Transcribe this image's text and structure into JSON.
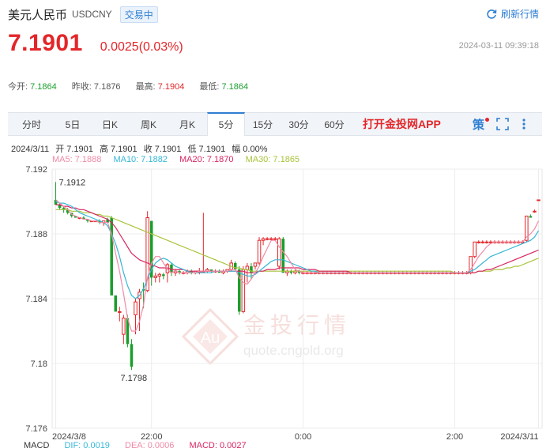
{
  "header": {
    "name": "美元人民币",
    "code": "USDCNY",
    "status": "交易中",
    "refresh_label": "刷新行情"
  },
  "quote": {
    "price": "7.1901",
    "change": "0.0025(0.03%)",
    "timestamp": "2024-03-11 09:39:18"
  },
  "stats": {
    "open_label": "今开:",
    "open": "7.1864",
    "prev_label": "昨收:",
    "prev": "7.1876",
    "high_label": "最高:",
    "high": "7.1904",
    "low_label": "最低:",
    "low": "7.1864"
  },
  "tabs": [
    "分时",
    "5日",
    "日K",
    "周K",
    "月K",
    "5分",
    "15分",
    "30分",
    "60分"
  ],
  "active_tab": "5分",
  "app_link": "打开金投网APP",
  "strategy_label": "策",
  "ohlc": {
    "date": "2024/3/11",
    "open": "开 7.1901",
    "high": "高 7.1901",
    "close": "收 7.1901",
    "low": "低 7.1901",
    "amp": "幅 0.00%"
  },
  "ma_legend": {
    "ma5": "MA5: 7.1888",
    "ma10": "MA10: 7.1882",
    "ma20": "MA20: 7.1870",
    "ma30": "MA30: 7.1865"
  },
  "macd_legend": {
    "title": "MACD",
    "dif": "DIF: 0.0019",
    "dea": "DEA: 0.0006",
    "macd": "MACD: 0.0027"
  },
  "colors": {
    "up": "#e3262a",
    "down": "#1a9e2c",
    "ma5": "#f08aa6",
    "ma10": "#35b7d6",
    "ma20": "#d9245f",
    "ma30": "#a7c43a",
    "accent": "#2f7fd3"
  },
  "watermark": {
    "text": "金投行情",
    "url": "quote.cngold.org"
  },
  "chart_data": {
    "type": "candlestick",
    "y_ticks": [
      "7.192",
      "7.188",
      "7.184",
      "7.18",
      "7.176"
    ],
    "ylim": [
      7.176,
      7.192
    ],
    "x_ticks": [
      {
        "label": "2024/3/8",
        "i": 0
      },
      {
        "label": "22:00",
        "i": 24
      },
      {
        "label": "0:00",
        "i": 62
      },
      {
        "label": "2:00",
        "i": 100
      },
      {
        "label": "2024/3/11",
        "i": 121
      }
    ],
    "annotations": {
      "max": "7.1912",
      "min": "7.1798"
    },
    "grid": true,
    "candles": [
      [
        7.1901,
        7.1912,
        7.1898,
        7.1898
      ],
      [
        7.1898,
        7.1899,
        7.1895,
        7.1896
      ],
      [
        7.1896,
        7.1897,
        7.1893,
        7.1895
      ],
      [
        7.1895,
        7.1896,
        7.1892,
        7.1893
      ],
      [
        7.1893,
        7.1893,
        7.189,
        7.1891
      ],
      [
        7.1891,
        7.1891,
        7.189,
        7.189
      ],
      [
        7.189,
        7.189,
        7.1889,
        7.189
      ],
      [
        7.189,
        7.1891,
        7.1889,
        7.1889
      ],
      [
        7.1889,
        7.1889,
        7.1887,
        7.1888
      ],
      [
        7.1888,
        7.1888,
        7.1888,
        7.1888
      ],
      [
        7.1888,
        7.1888,
        7.1888,
        7.1888
      ],
      [
        7.1888,
        7.1889,
        7.1886,
        7.1887
      ],
      [
        7.1887,
        7.1888,
        7.1885,
        7.1888
      ],
      [
        7.1889,
        7.189,
        7.1887,
        7.1887
      ],
      [
        7.189,
        7.1891,
        7.1848,
        7.1842
      ],
      [
        7.1842,
        7.1842,
        7.1832,
        7.1832
      ],
      [
        7.1832,
        7.1835,
        7.1826,
        7.1832
      ],
      [
        7.1818,
        7.183,
        7.1812,
        7.1828
      ],
      [
        7.1828,
        7.183,
        7.181,
        7.1812
      ],
      [
        7.1812,
        7.1815,
        7.1796,
        7.1798
      ],
      [
        7.183,
        7.184,
        7.1818,
        7.1838
      ],
      [
        7.184,
        7.1846,
        7.182,
        7.1844
      ],
      [
        7.1846,
        7.185,
        7.1834,
        7.1845
      ],
      [
        7.1845,
        7.1894,
        7.1844,
        7.189
      ],
      [
        7.1888,
        7.1888,
        7.1848,
        7.1853
      ],
      [
        7.1853,
        7.1856,
        7.185,
        7.1854
      ],
      [
        7.1854,
        7.1856,
        7.185,
        7.1855
      ],
      [
        7.1855,
        7.1856,
        7.1852,
        7.1854
      ],
      [
        7.1856,
        7.1862,
        7.185,
        7.1861
      ],
      [
        7.1861,
        7.1862,
        7.1854,
        7.1856
      ],
      [
        7.1856,
        7.1858,
        7.1854,
        7.1857
      ],
      [
        7.1857,
        7.1858,
        7.1855,
        7.1856
      ],
      [
        7.1856,
        7.1857,
        7.1855,
        7.1856
      ],
      [
        7.1856,
        7.1858,
        7.1855,
        7.1857
      ],
      [
        7.1857,
        7.1858,
        7.1855,
        7.1856
      ],
      [
        7.1856,
        7.1857,
        7.1855,
        7.1857
      ],
      [
        7.1857,
        7.1859,
        7.1855,
        7.1857
      ],
      [
        7.1857,
        7.1893,
        7.1857,
        7.1857
      ],
      [
        7.1857,
        7.1859,
        7.1856,
        7.1858
      ],
      [
        7.1858,
        7.1858,
        7.1856,
        7.1857
      ],
      [
        7.1857,
        7.1858,
        7.1856,
        7.1857
      ],
      [
        7.1857,
        7.1858,
        7.1856,
        7.1856
      ],
      [
        7.1856,
        7.1858,
        7.1855,
        7.1857
      ],
      [
        7.1857,
        7.1858,
        7.1856,
        7.1858
      ],
      [
        7.1858,
        7.1864,
        7.1857,
        7.1862
      ],
      [
        7.1862,
        7.1863,
        7.1858,
        7.1858
      ],
      [
        7.1858,
        7.186,
        7.183,
        7.1832
      ],
      [
        7.1832,
        7.186,
        7.1831,
        7.1858
      ],
      [
        7.1858,
        7.1862,
        7.185,
        7.186
      ],
      [
        7.186,
        7.1862,
        7.1852,
        7.1856
      ],
      [
        7.186,
        7.1862,
        7.1858,
        7.1862
      ],
      [
        7.1862,
        7.1878,
        7.1861,
        7.1876
      ],
      [
        7.1876,
        7.1878,
        7.1873,
        7.1877
      ],
      [
        7.1877,
        7.1878,
        7.1876,
        7.1877
      ],
      [
        7.1877,
        7.1878,
        7.1876,
        7.1877
      ],
      [
        7.1877,
        7.1878,
        7.1876,
        7.1877
      ],
      [
        7.186,
        7.1878,
        7.1858,
        7.1877
      ],
      [
        7.1877,
        7.1878,
        7.1856,
        7.1856
      ],
      [
        7.1856,
        7.1858,
        7.1854,
        7.1857
      ],
      [
        7.1857,
        7.1858,
        7.1855,
        7.1856
      ],
      [
        7.1856,
        7.1858,
        7.1855,
        7.1857
      ],
      [
        7.1857,
        7.1858,
        7.1855,
        7.1856
      ],
      [
        7.1856,
        7.1857,
        7.1855,
        7.1856
      ],
      [
        7.1856,
        7.1857,
        7.1855,
        7.1856
      ],
      [
        7.1856,
        7.1857,
        7.1855,
        7.1856
      ],
      [
        7.1856,
        7.1857,
        7.1855,
        7.1856
      ],
      [
        7.1856,
        7.1857,
        7.1855,
        7.1856
      ],
      [
        7.1856,
        7.1857,
        7.1855,
        7.1856
      ],
      [
        7.1856,
        7.1857,
        7.1855,
        7.1856
      ],
      [
        7.1856,
        7.1857,
        7.1855,
        7.1856
      ],
      [
        7.1856,
        7.1857,
        7.1855,
        7.1856
      ],
      [
        7.1856,
        7.1857,
        7.1855,
        7.1856
      ],
      [
        7.1856,
        7.1857,
        7.1855,
        7.1856
      ],
      [
        7.1856,
        7.1857,
        7.1855,
        7.1856
      ],
      [
        7.1856,
        7.1857,
        7.1855,
        7.1856
      ],
      [
        7.1856,
        7.1857,
        7.1855,
        7.1856
      ],
      [
        7.1856,
        7.1857,
        7.1855,
        7.1856
      ],
      [
        7.1856,
        7.1857,
        7.1855,
        7.1856
      ],
      [
        7.1856,
        7.1857,
        7.1855,
        7.1856
      ],
      [
        7.1856,
        7.1857,
        7.1855,
        7.1856
      ],
      [
        7.1856,
        7.1857,
        7.1855,
        7.1856
      ],
      [
        7.1856,
        7.1857,
        7.1855,
        7.1856
      ],
      [
        7.1856,
        7.1857,
        7.1855,
        7.1856
      ],
      [
        7.1856,
        7.1857,
        7.1855,
        7.1856
      ],
      [
        7.1856,
        7.1857,
        7.1855,
        7.1856
      ],
      [
        7.1856,
        7.1857,
        7.1855,
        7.1856
      ],
      [
        7.1856,
        7.1857,
        7.1855,
        7.1856
      ],
      [
        7.1856,
        7.1857,
        7.1855,
        7.1856
      ],
      [
        7.1856,
        7.1857,
        7.1855,
        7.1856
      ],
      [
        7.1856,
        7.1857,
        7.1855,
        7.1856
      ],
      [
        7.1856,
        7.1857,
        7.1855,
        7.1856
      ],
      [
        7.1856,
        7.1857,
        7.1855,
        7.1856
      ],
      [
        7.1856,
        7.1857,
        7.1855,
        7.1856
      ],
      [
        7.1856,
        7.1857,
        7.1855,
        7.1856
      ],
      [
        7.1856,
        7.1857,
        7.1855,
        7.1856
      ],
      [
        7.1856,
        7.1857,
        7.1855,
        7.1856
      ],
      [
        7.1856,
        7.1857,
        7.1855,
        7.1856
      ],
      [
        7.1856,
        7.1857,
        7.1855,
        7.1856
      ],
      [
        7.1856,
        7.1857,
        7.1855,
        7.1856
      ],
      [
        7.1856,
        7.1857,
        7.1855,
        7.1856
      ],
      [
        7.1856,
        7.1857,
        7.1855,
        7.1856
      ],
      [
        7.1856,
        7.1857,
        7.1855,
        7.1856
      ],
      [
        7.1856,
        7.1857,
        7.1855,
        7.1856
      ],
      [
        7.1856,
        7.1857,
        7.1855,
        7.1856
      ],
      [
        7.1856,
        7.1866,
        7.1855,
        7.1866
      ],
      [
        7.1866,
        7.1875,
        7.1865,
        7.1875
      ],
      [
        7.1875,
        7.1876,
        7.1874,
        7.1875
      ],
      [
        7.1875,
        7.1876,
        7.1874,
        7.1875
      ],
      [
        7.1875,
        7.1876,
        7.1874,
        7.1875
      ],
      [
        7.1875,
        7.1876,
        7.1874,
        7.1875
      ],
      [
        7.1875,
        7.1876,
        7.1874,
        7.1875
      ],
      [
        7.1875,
        7.1876,
        7.1874,
        7.1875
      ],
      [
        7.1875,
        7.1876,
        7.1874,
        7.1875
      ],
      [
        7.1875,
        7.1876,
        7.1874,
        7.1875
      ],
      [
        7.1875,
        7.1876,
        7.1874,
        7.1875
      ],
      [
        7.1875,
        7.1876,
        7.1874,
        7.1875
      ],
      [
        7.1875,
        7.1876,
        7.1874,
        7.1875
      ],
      [
        7.1875,
        7.1876,
        7.1874,
        7.1875
      ],
      [
        7.1876,
        7.1891,
        7.1875,
        7.1891
      ],
      [
        7.1891,
        7.1892,
        7.189,
        7.189
      ],
      [
        7.1894,
        7.1895,
        7.1893,
        7.1894
      ],
      [
        7.1901,
        7.1901,
        7.1901,
        7.1901
      ]
    ],
    "ma5": [
      7.1901,
      7.1899,
      7.1897,
      7.1895,
      7.1892,
      7.1891,
      7.189,
      7.1889,
      7.1889,
      7.1888,
      7.1888,
      7.1887,
      7.1887,
      7.1887,
      7.188,
      7.1868,
      7.1857,
      7.1843,
      7.1828,
      7.182,
      7.182,
      7.1826,
      7.1836,
      7.1853,
      7.1862,
      7.1866,
      7.1866,
      7.1862,
      7.1858,
      7.1856,
      7.1857,
      7.1856,
      7.1856,
      7.1856,
      7.1856,
      7.1856,
      7.1857,
      7.1857,
      7.1857,
      7.1857,
      7.1857,
      7.1857,
      7.1857,
      7.1857,
      7.1858,
      7.1858,
      7.1853,
      7.185,
      7.1849,
      7.1852,
      7.1856,
      7.186,
      7.1866,
      7.1871,
      7.1876,
      7.1876,
      7.1872,
      7.1869,
      7.1866,
      7.1862,
      7.1858,
      7.1857,
      7.1856,
      7.1856,
      7.1856,
      7.1856,
      7.1856,
      7.1856,
      7.1856,
      7.1856,
      7.1856,
      7.1856,
      7.1856,
      7.1856,
      7.1856,
      7.1856,
      7.1856,
      7.1856,
      7.1856,
      7.1856,
      7.1856,
      7.1856,
      7.1856,
      7.1856,
      7.1856,
      7.1856,
      7.1856,
      7.1856,
      7.1856,
      7.1856,
      7.1856,
      7.1856,
      7.1856,
      7.1856,
      7.1856,
      7.1856,
      7.1856,
      7.1856,
      7.1856,
      7.1856,
      7.1856,
      7.1856,
      7.1856,
      7.1856,
      7.1858,
      7.1862,
      7.1866,
      7.1869,
      7.1872,
      7.1874,
      7.1875,
      7.1875,
      7.1875,
      7.1875,
      7.1875,
      7.1875,
      7.1875,
      7.1875,
      7.1878,
      7.188,
      7.1883,
      7.1888
    ],
    "ma10": [
      7.19,
      7.1899,
      7.1899,
      7.1898,
      7.1897,
      7.1895,
      7.1893,
      7.1892,
      7.1891,
      7.189,
      7.1889,
      7.1888,
      7.1887,
      7.1885,
      7.188,
      7.1874,
      7.1866,
      7.1856,
      7.1848,
      7.1842,
      7.184,
      7.1842,
      7.1846,
      7.1852,
      7.1858,
      7.1862,
      7.1864,
      7.1865,
      7.1864,
      7.1862,
      7.186,
      7.1859,
      7.1858,
      7.1857,
      7.1856,
      7.1856,
      7.1856,
      7.1856,
      7.1856,
      7.1856,
      7.1857,
      7.1857,
      7.1857,
      7.1857,
      7.1857,
      7.1857,
      7.1856,
      7.1855,
      7.1854,
      7.1854,
      7.1855,
      7.1857,
      7.1859,
      7.1861,
      7.1863,
      7.1864,
      7.1864,
      7.1864,
      7.1863,
      7.1862,
      7.1861,
      7.186,
      7.1859,
      7.1858,
      7.1857,
      7.1857,
      7.1856,
      7.1856,
      7.1856,
      7.1856,
      7.1856,
      7.1856,
      7.1856,
      7.1856,
      7.1856,
      7.1856,
      7.1856,
      7.1856,
      7.1856,
      7.1856,
      7.1856,
      7.1856,
      7.1856,
      7.1856,
      7.1856,
      7.1856,
      7.1856,
      7.1856,
      7.1856,
      7.1856,
      7.1856,
      7.1856,
      7.1856,
      7.1856,
      7.1856,
      7.1856,
      7.1856,
      7.1856,
      7.1856,
      7.1856,
      7.1856,
      7.1856,
      7.1856,
      7.1856,
      7.1857,
      7.1858,
      7.186,
      7.1862,
      7.1864,
      7.1866,
      7.1867,
      7.1868,
      7.1869,
      7.187,
      7.1871,
      7.1872,
      7.1873,
      7.1874,
      7.1875,
      7.1876,
      7.1878,
      7.1882
    ],
    "ma20": [
      7.1898,
      7.1898,
      7.1897,
      7.1897,
      7.1896,
      7.1896,
      7.1895,
      7.1895,
      7.1894,
      7.1893,
      7.1892,
      7.1891,
      7.189,
      7.1889,
      7.1887,
      7.1884,
      7.188,
      7.1876,
      7.1872,
      7.1868,
      7.1866,
      7.1864,
      7.1863,
      7.1862,
      7.1861,
      7.186,
      7.1859,
      7.1859,
      7.1859,
      7.1858,
      7.1858,
      7.1858,
      7.1858,
      7.1857,
      7.1857,
      7.1857,
      7.1857,
      7.1857,
      7.1857,
      7.1857,
      7.1857,
      7.1857,
      7.1857,
      7.1857,
      7.1857,
      7.1857,
      7.1857,
      7.1857,
      7.1856,
      7.1856,
      7.1856,
      7.1857,
      7.1857,
      7.1858,
      7.1858,
      7.1858,
      7.1859,
      7.1859,
      7.1859,
      7.1859,
      7.1859,
      7.1859,
      7.1858,
      7.1858,
      7.1858,
      7.1858,
      7.1857,
      7.1857,
      7.1857,
      7.1857,
      7.1857,
      7.1857,
      7.1857,
      7.1857,
      7.1856,
      7.1856,
      7.1856,
      7.1856,
      7.1856,
      7.1856,
      7.1856,
      7.1856,
      7.1856,
      7.1856,
      7.1856,
      7.1856,
      7.1856,
      7.1856,
      7.1856,
      7.1856,
      7.1856,
      7.1856,
      7.1856,
      7.1856,
      7.1856,
      7.1856,
      7.1856,
      7.1856,
      7.1856,
      7.1856,
      7.1856,
      7.1856,
      7.1856,
      7.1856,
      7.1856,
      7.1856,
      7.1857,
      7.1857,
      7.1858,
      7.1858,
      7.1859,
      7.186,
      7.1861,
      7.1862,
      7.1863,
      7.1864,
      7.1865,
      7.1866,
      7.1867,
      7.1868,
      7.1869,
      7.187
    ],
    "ma30": [
      7.1895,
      7.1895,
      7.1895,
      7.1895,
      7.1894,
      7.1894,
      7.1894,
      7.1893,
      7.1893,
      7.1893,
      7.1892,
      7.1892,
      7.1891,
      7.1891,
      7.189,
      7.1889,
      7.1888,
      7.1887,
      7.1886,
      7.1885,
      7.1884,
      7.1883,
      7.1882,
      7.1881,
      7.188,
      7.1879,
      7.1878,
      7.1877,
      7.1876,
      7.1875,
      7.1874,
      7.1873,
      7.1872,
      7.1871,
      7.187,
      7.1869,
      7.1868,
      7.1867,
      7.1866,
      7.1865,
      7.1864,
      7.1863,
      7.1862,
      7.1861,
      7.186,
      7.1859,
      7.1859,
      7.1858,
      7.1858,
      7.1857,
      7.1857,
      7.1857,
      7.1857,
      7.1857,
      7.1857,
      7.1857,
      7.1857,
      7.1857,
      7.1857,
      7.1857,
      7.1857,
      7.1857,
      7.1857,
      7.1857,
      7.1857,
      7.1857,
      7.1857,
      7.1857,
      7.1857,
      7.1857,
      7.1857,
      7.1857,
      7.1857,
      7.1857,
      7.1857,
      7.1857,
      7.1857,
      7.1857,
      7.1857,
      7.1857,
      7.1857,
      7.1857,
      7.1857,
      7.1857,
      7.1857,
      7.1857,
      7.1857,
      7.1857,
      7.1857,
      7.1857,
      7.1857,
      7.1857,
      7.1857,
      7.1857,
      7.1857,
      7.1857,
      7.1857,
      7.1857,
      7.1857,
      7.1857,
      7.1856,
      7.1856,
      7.1856,
      7.1856,
      7.1856,
      7.1856,
      7.1857,
      7.1857,
      7.1857,
      7.1857,
      7.1858,
      7.1858,
      7.1858,
      7.1859,
      7.1859,
      7.186,
      7.186,
      7.1861,
      7.1862,
      7.1863,
      7.1864,
      7.1865
    ]
  }
}
